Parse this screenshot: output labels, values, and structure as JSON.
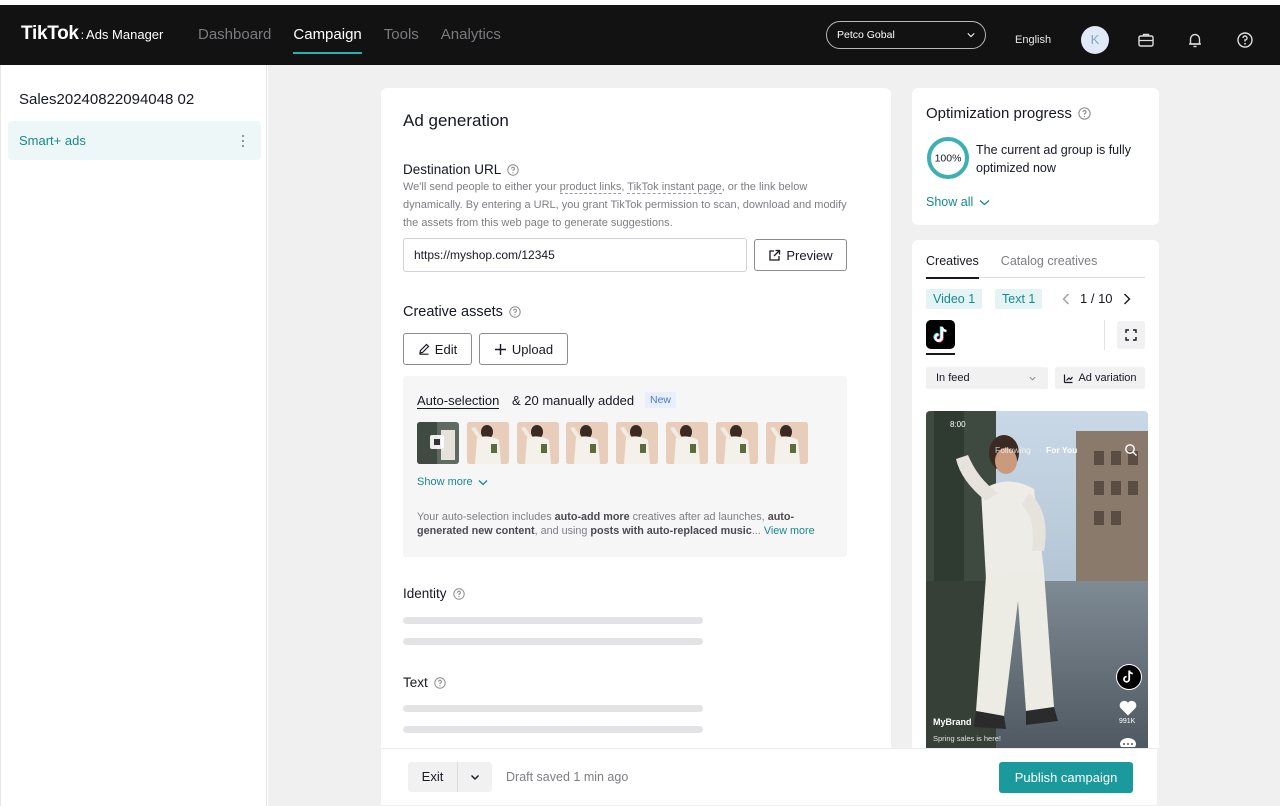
{
  "topbar": {
    "logo_main": "TikTok",
    "logo_sep": ":",
    "logo_sub": "Ads Manager",
    "nav": [
      "Dashboard",
      "Campaign",
      "Tools",
      "Analytics"
    ],
    "active_nav": "Campaign",
    "account": "Petco Gobal",
    "language": "English",
    "avatar_initial": "K",
    "icons": [
      "briefcase-icon",
      "bell-icon",
      "help-circle-icon"
    ]
  },
  "sidebar": {
    "campaign_name": "Sales20240822094048 02",
    "items": [
      {
        "label": "Smart+ ads",
        "selected": true
      }
    ]
  },
  "ad_generation": {
    "title": "Ad generation",
    "destination": {
      "label": "Destination URL",
      "desc_1": "We'll send people to either your ",
      "link_product": "product links",
      "desc_2": ", ",
      "link_instant": "TikTok instant page",
      "desc_3": ", or the link below dynamically. By entering a URL, you grant TikTok permission to scan, download and modify the assets from this web page to generate suggestions.",
      "url_value": "https://myshop.com/12345",
      "preview_label": "Preview"
    },
    "creative_assets": {
      "label": "Creative assets",
      "edit_label": "Edit",
      "upload_label": "Upload",
      "auto_selection": "Auto-selection",
      "manual_added": "& 20 manually added",
      "badge": "New",
      "thumbnail_count": 8,
      "show_more": "Show more",
      "note_1": "Your auto-selection includes ",
      "note_b1": "auto-add more",
      "note_2": " creatives after ad launches, ",
      "note_b2": "auto-generated new content",
      "note_3": ", and using ",
      "note_b3": "posts with auto-replaced music",
      "note_4": "... ",
      "view_more": "View more"
    },
    "identity_label": "Identity",
    "text_label": "Text"
  },
  "bottom_bar": {
    "exit_label": "Exit",
    "draft_status": "Draft saved 1 min ago",
    "publish_label": "Publish campaign"
  },
  "optimization": {
    "title": "Optimization progress",
    "percent": 100,
    "percent_label": "100%",
    "message": "The current ad group is fully optimized now",
    "show_all": "Show all"
  },
  "preview": {
    "tabs": [
      "Creatives",
      "Catalog creatives"
    ],
    "active_tab": "Creatives",
    "chips": [
      "Video 1",
      "Text 1"
    ],
    "pager": "1 / 10",
    "placement": "In feed",
    "ad_variation": "Ad variation",
    "phone": {
      "time": "8:00",
      "following": "Following",
      "for_you": "For You",
      "likes": "991K",
      "brand": "MyBrand",
      "caption": "Spring sales is here!"
    }
  },
  "colors": {
    "accent": "#1a9a9c",
    "accent_text": "#168a8c",
    "topbar": "#121212",
    "page_bg": "#f0f0f0"
  }
}
